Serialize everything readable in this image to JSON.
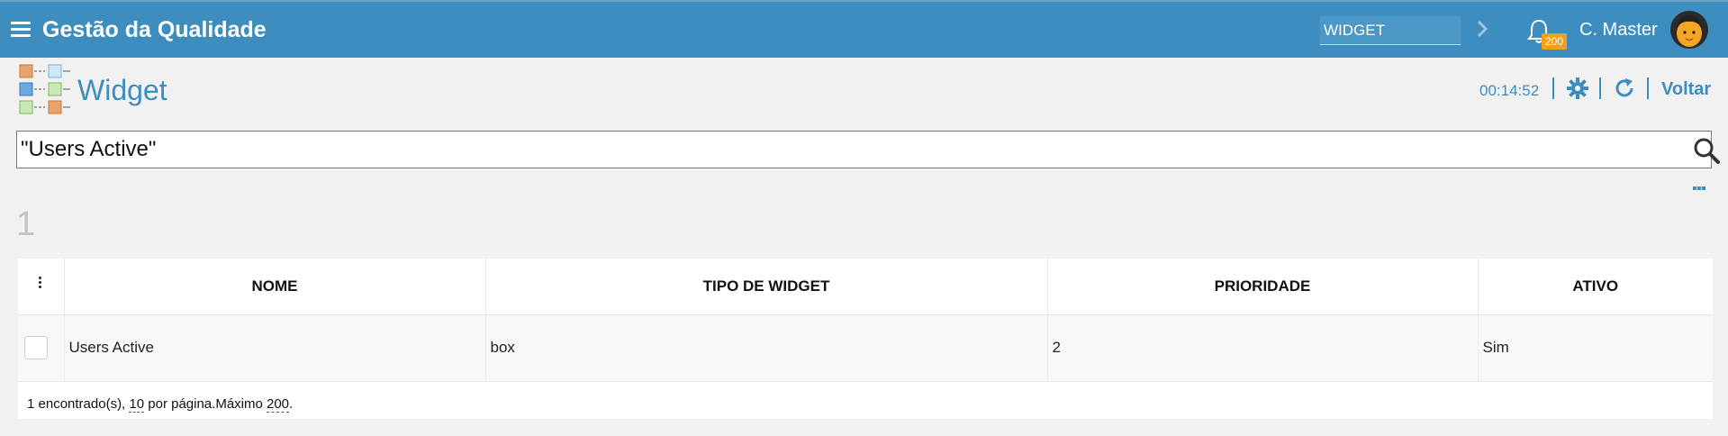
{
  "app": {
    "title": "Gestão da Qualidade",
    "module_input_value": "WIDGET",
    "notification_count": "200",
    "user_name": "C. Master",
    "brand_color": "#3d8dbf",
    "badge_color": "#f1a119"
  },
  "page": {
    "title": "Widget",
    "timer": "00:14:52",
    "back_label": "Voltar"
  },
  "search": {
    "value": "\"Users Active\""
  },
  "results": {
    "count": "1"
  },
  "table": {
    "columns": [
      "NOME",
      "TIPO DE WIDGET",
      "PRIORIDADE",
      "ATIVO"
    ],
    "rows": [
      {
        "nome": "Users Active",
        "tipo": "box",
        "prioridade": "2",
        "ativo": "Sim"
      }
    ],
    "footer": {
      "found_text": "1 encontrado(s), ",
      "per_page": "10",
      "per_page_text": " por página.Máximo ",
      "max": "200",
      "end": "."
    }
  },
  "icons": {
    "menu": "hamburger-icon",
    "chevron": "chevron-right-icon",
    "bell": "bell-icon",
    "avatar": "avatar",
    "gear": "gear-icon",
    "refresh": "refresh-icon",
    "search": "search-icon",
    "more": "more-icon",
    "kebab": "kebab-icon"
  }
}
